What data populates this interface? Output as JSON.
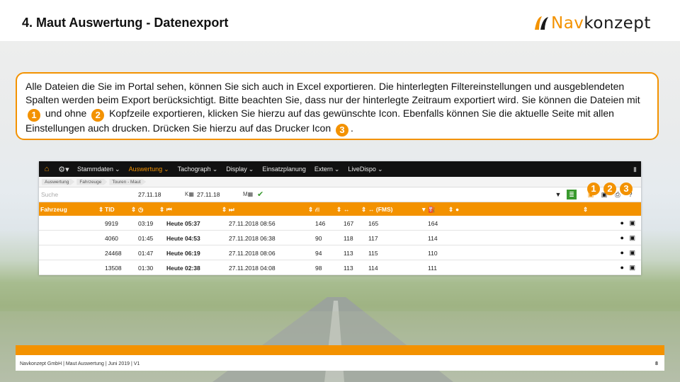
{
  "slide": {
    "title": "4. Maut Auswertung - Datenexport",
    "logo": {
      "part1": "Nav",
      "part2": "konzept"
    },
    "info": {
      "seg1": "Alle Dateien die Sie im Portal sehen, können Sie sich auch in Excel exportieren. Die hinterlegten Filtereinstellungen und ausgeblendeten Spalten werden beim Export berücksichtigt. Bitte beachten Sie, dass nur der hinterlegte Zeitraum exportiert wird. Sie können die Dateien mit",
      "n1": "1",
      "seg2": "und ohne",
      "n2": "2",
      "seg3": "Kopfzeile exportieren, klicken Sie hierzu auf das gewünschte Icon. Ebenfalls können Sie die aktuelle Seite mit allen Einstellungen auch drucken. Drücken Sie hierzu auf das Drucker Icon",
      "n3": "3",
      "seg4": "."
    },
    "footer": {
      "text": "Navkonzept GmbH  |  Maut Auswertung  |  Juni 2019  |  V1",
      "page": "8"
    }
  },
  "app": {
    "nav": {
      "items": [
        {
          "label": "Stammdaten",
          "dropdown": true
        },
        {
          "label": "Auswertung",
          "dropdown": true,
          "active": true
        },
        {
          "label": "Tachograph",
          "dropdown": true
        },
        {
          "label": "Display",
          "dropdown": true
        },
        {
          "label": "Einsatzplanung",
          "dropdown": false
        },
        {
          "label": "Extern",
          "dropdown": true
        },
        {
          "label": "LiveDispo",
          "dropdown": true
        }
      ]
    },
    "breadcrumbs": [
      "Auswertung",
      "Fahrzeuge",
      "Touren - Maut"
    ],
    "filter": {
      "search_placeholder": "Suche",
      "date_from": "27.11.18",
      "date_to": "27.11.18"
    },
    "badges": [
      "1",
      "2",
      "3"
    ],
    "table": {
      "headers": [
        "Fahrzeug",
        "TID",
        "",
        "",
        "",
        "",
        "",
        "↔ (FMS)",
        "",
        ""
      ],
      "rows": [
        {
          "vehicle": "",
          "tid": "9919",
          "dur": "03:19",
          "start": "Heute 05:37",
          "end": "27.11.2018 08:56",
          "c1": "146",
          "c2": "167",
          "fms": "165",
          "c3": "164",
          "driver": ""
        },
        {
          "vehicle": "",
          "tid": "4060",
          "dur": "01:45",
          "start": "Heute 04:53",
          "end": "27.11.2018 06:38",
          "c1": "90",
          "c2": "118",
          "fms": "117",
          "c3": "114",
          "driver": ""
        },
        {
          "vehicle": "",
          "tid": "24468",
          "dur": "01:47",
          "start": "Heute 06:19",
          "end": "27.11.2018 08:06",
          "c1": "94",
          "c2": "113",
          "fms": "115",
          "c3": "110",
          "driver": ""
        },
        {
          "vehicle": "",
          "tid": "13508",
          "dur": "01:30",
          "start": "Heute 02:38",
          "end": "27.11.2018 04:08",
          "c1": "98",
          "c2": "113",
          "fms": "114",
          "c3": "111",
          "driver": ""
        }
      ]
    }
  }
}
